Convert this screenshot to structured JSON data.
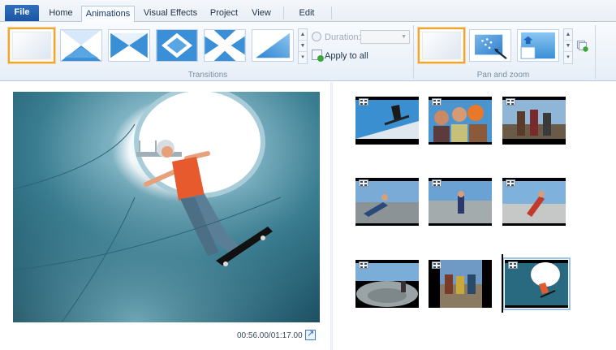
{
  "tabs": [
    {
      "label": "File"
    },
    {
      "label": "Home"
    },
    {
      "label": "Animations"
    },
    {
      "label": "Visual Effects"
    },
    {
      "label": "Project"
    },
    {
      "label": "View"
    },
    {
      "label": "Edit"
    }
  ],
  "active_tab": "Animations",
  "ribbon": {
    "transitions": {
      "group_label": "Transitions",
      "items": [
        "No transition",
        "Diagonal box",
        "Bow tie",
        "Diamond",
        "Cross",
        "Diagonal wipe"
      ],
      "selected_index": 0
    },
    "duration": {
      "label": "Duration:",
      "value": ""
    },
    "apply_to_all": "Apply to all",
    "pan_zoom": {
      "group_label": "Pan and zoom",
      "items": [
        "No pan and zoom",
        "Automatic",
        "Zoom in"
      ],
      "selected_index": 0
    }
  },
  "preview": {
    "timecode": "00:56.00/01:17.00"
  },
  "storyboard": {
    "clips": [
      {
        "name": "Skater on ramp"
      },
      {
        "name": "Three friends"
      },
      {
        "name": "Friends standing"
      },
      {
        "name": "Skater grind"
      },
      {
        "name": "Skater carving"
      },
      {
        "name": "Skater in bowl"
      },
      {
        "name": "Skatepark bowl"
      },
      {
        "name": "Friends sitting"
      },
      {
        "name": "Skater in pipe"
      }
    ],
    "selected_index": 8
  },
  "colors": {
    "file_tab": "#1c56a4",
    "selection_orange": "#f0a530",
    "ribbon_bg": "#e6eef7"
  }
}
